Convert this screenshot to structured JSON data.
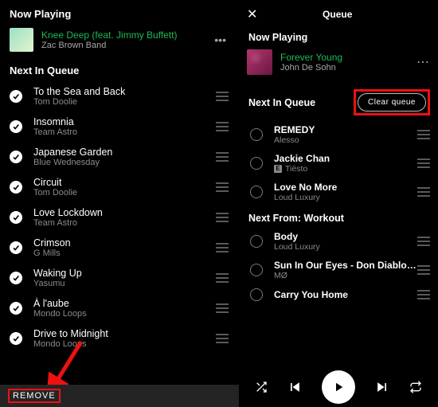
{
  "left": {
    "now_playing_label": "Now Playing",
    "now_playing": {
      "title": "Knee Deep (feat. Jimmy Buffett)",
      "artist": "Zac Brown Band"
    },
    "next_in_queue_label": "Next In Queue",
    "queue": [
      {
        "title": "To the Sea and Back",
        "artist": "Tom Doolie"
      },
      {
        "title": "Insomnia",
        "artist": "Team Astro"
      },
      {
        "title": "Japanese Garden",
        "artist": "Blue Wednesday"
      },
      {
        "title": "Circuit",
        "artist": "Tom Doolie"
      },
      {
        "title": "Love Lockdown",
        "artist": "Team Astro"
      },
      {
        "title": "Crimson",
        "artist": "G Mills"
      },
      {
        "title": "Waking Up",
        "artist": "Yasumu"
      },
      {
        "title": "À l'aube",
        "artist": "Mondo Loops"
      },
      {
        "title": "Drive to Midnight",
        "artist": "Mondo Loops"
      }
    ],
    "remove_label": "REMOVE"
  },
  "right": {
    "header": "Queue",
    "now_playing_label": "Now Playing",
    "now_playing": {
      "title": "Forever Young",
      "artist": "John De Sohn"
    },
    "next_in_queue_label": "Next In Queue",
    "clear_queue_label": "Clear queue",
    "queue": [
      {
        "title": "REMEDY",
        "artist": "Alesso",
        "explicit": false
      },
      {
        "title": "Jackie Chan",
        "artist": "Tiësto",
        "explicit": true
      },
      {
        "title": "Love No More",
        "artist": "Loud Luxury",
        "explicit": false
      }
    ],
    "next_from_label": "Next From: Workout",
    "next_from": [
      {
        "title": "Body",
        "artist": "Loud Luxury"
      },
      {
        "title": "Sun In Our Eyes - Don Diablo Re...",
        "artist": "MØ"
      },
      {
        "title": "Carry You Home",
        "artist": ""
      }
    ]
  }
}
